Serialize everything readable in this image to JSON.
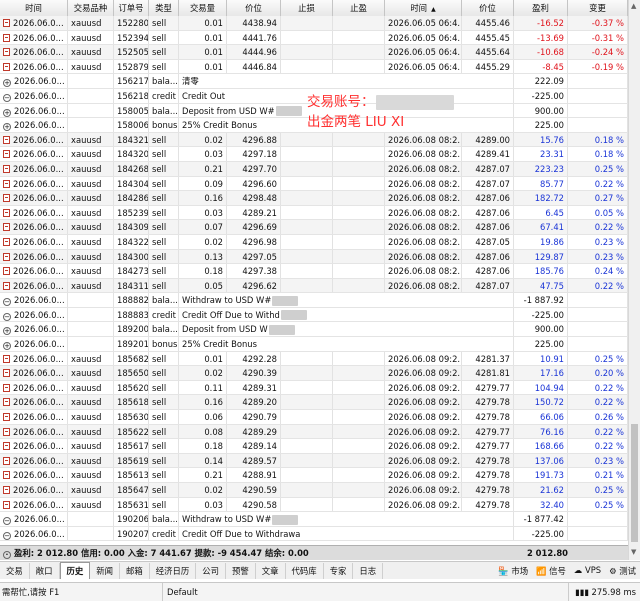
{
  "headers": [
    "时间",
    "交易品种",
    "订单号",
    "类型",
    "交易量",
    "价位",
    "止损",
    "止盈",
    "时间",
    "价位",
    "盈利",
    "变更"
  ],
  "sort_indicator": "▲",
  "rows": [
    {
      "kind": "trade",
      "time": "2026.06.0...",
      "symbol": "xauusd",
      "order": "152280",
      "type": "sell",
      "vol": "0.01",
      "price": "4438.94",
      "sl": "",
      "tp": "",
      "ctime": "2026.06.05 06:4...",
      "cprice": "4455.46",
      "profit": "-16.52",
      "chg": "-0.37 %",
      "sign": "neg"
    },
    {
      "kind": "trade",
      "time": "2026.06.0...",
      "symbol": "xauusd",
      "order": "152394",
      "type": "sell",
      "vol": "0.01",
      "price": "4441.76",
      "sl": "",
      "tp": "",
      "ctime": "2026.06.05 06:4...",
      "cprice": "4455.45",
      "profit": "-13.69",
      "chg": "-0.31 %",
      "sign": "neg"
    },
    {
      "kind": "trade",
      "time": "2026.06.0...",
      "symbol": "xauusd",
      "order": "152505",
      "type": "sell",
      "vol": "0.01",
      "price": "4444.96",
      "sl": "",
      "tp": "",
      "ctime": "2026.06.05 06:4...",
      "cprice": "4455.64",
      "profit": "-10.68",
      "chg": "-0.24 %",
      "sign": "neg"
    },
    {
      "kind": "trade",
      "time": "2026.06.0...",
      "symbol": "xauusd",
      "order": "152879",
      "type": "sell",
      "vol": "0.01",
      "price": "4446.84",
      "sl": "",
      "tp": "",
      "ctime": "2026.06.05 06:4...",
      "cprice": "4455.29",
      "profit": "-8.45",
      "chg": "-0.19 %",
      "sign": "neg"
    },
    {
      "kind": "bal",
      "mark": "+",
      "time": "2026.06.0...",
      "order": "156217",
      "type": "bala...",
      "comment": "清零",
      "masked": false,
      "profit": "222.09"
    },
    {
      "kind": "bal",
      "mark": "-",
      "time": "2026.06.0...",
      "order": "156218",
      "type": "credit",
      "comment": "Credit Out",
      "masked": false,
      "profit": "-225.00"
    },
    {
      "kind": "bal",
      "mark": "+",
      "time": "2026.06.0...",
      "order": "158005",
      "type": "bala...",
      "comment": "Deposit from USD W#",
      "masked": true,
      "profit": "900.00"
    },
    {
      "kind": "bal",
      "mark": "+",
      "time": "2026.06.0...",
      "order": "158006",
      "type": "bonus",
      "comment": "25% Credit Bonus",
      "masked": false,
      "profit": "225.00"
    },
    {
      "kind": "trade",
      "time": "2026.06.0...",
      "symbol": "xauusd",
      "order": "184321",
      "type": "sell",
      "vol": "0.02",
      "price": "4296.88",
      "sl": "",
      "tp": "",
      "ctime": "2026.06.08 08:2...",
      "cprice": "4289.00",
      "profit": "15.76",
      "chg": "0.18 %",
      "sign": "pos"
    },
    {
      "kind": "trade",
      "time": "2026.06.0...",
      "symbol": "xauusd",
      "order": "184320",
      "type": "sell",
      "vol": "0.03",
      "price": "4297.18",
      "sl": "",
      "tp": "",
      "ctime": "2026.06.08 08:2...",
      "cprice": "4289.41",
      "profit": "23.31",
      "chg": "0.18 %",
      "sign": "pos"
    },
    {
      "kind": "trade",
      "time": "2026.06.0...",
      "symbol": "xauusd",
      "order": "184268",
      "type": "sell",
      "vol": "0.21",
      "price": "4297.70",
      "sl": "",
      "tp": "",
      "ctime": "2026.06.08 08:2...",
      "cprice": "4287.07",
      "profit": "223.23",
      "chg": "0.25 %",
      "sign": "pos"
    },
    {
      "kind": "trade",
      "time": "2026.06.0...",
      "symbol": "xauusd",
      "order": "184304",
      "type": "sell",
      "vol": "0.09",
      "price": "4296.60",
      "sl": "",
      "tp": "",
      "ctime": "2026.06.08 08:2...",
      "cprice": "4287.07",
      "profit": "85.77",
      "chg": "0.22 %",
      "sign": "pos"
    },
    {
      "kind": "trade",
      "time": "2026.06.0...",
      "symbol": "xauusd",
      "order": "184286",
      "type": "sell",
      "vol": "0.16",
      "price": "4298.48",
      "sl": "",
      "tp": "",
      "ctime": "2026.06.08 08:2...",
      "cprice": "4287.06",
      "profit": "182.72",
      "chg": "0.27 %",
      "sign": "pos"
    },
    {
      "kind": "trade",
      "time": "2026.06.0...",
      "symbol": "xauusd",
      "order": "185239",
      "type": "sell",
      "vol": "0.03",
      "price": "4289.21",
      "sl": "",
      "tp": "",
      "ctime": "2026.06.08 08:2...",
      "cprice": "4287.06",
      "profit": "6.45",
      "chg": "0.05 %",
      "sign": "pos"
    },
    {
      "kind": "trade",
      "time": "2026.06.0...",
      "symbol": "xauusd",
      "order": "184309",
      "type": "sell",
      "vol": "0.07",
      "price": "4296.69",
      "sl": "",
      "tp": "",
      "ctime": "2026.06.08 08:2...",
      "cprice": "4287.06",
      "profit": "67.41",
      "chg": "0.22 %",
      "sign": "pos"
    },
    {
      "kind": "trade",
      "time": "2026.06.0...",
      "symbol": "xauusd",
      "order": "184322",
      "type": "sell",
      "vol": "0.02",
      "price": "4296.98",
      "sl": "",
      "tp": "",
      "ctime": "2026.06.08 08:2...",
      "cprice": "4287.05",
      "profit": "19.86",
      "chg": "0.23 %",
      "sign": "pos"
    },
    {
      "kind": "trade",
      "time": "2026.06.0...",
      "symbol": "xauusd",
      "order": "184300",
      "type": "sell",
      "vol": "0.13",
      "price": "4297.05",
      "sl": "",
      "tp": "",
      "ctime": "2026.06.08 08:2...",
      "cprice": "4287.06",
      "profit": "129.87",
      "chg": "0.23 %",
      "sign": "pos"
    },
    {
      "kind": "trade",
      "time": "2026.06.0...",
      "symbol": "xauusd",
      "order": "184273",
      "type": "sell",
      "vol": "0.18",
      "price": "4297.38",
      "sl": "",
      "tp": "",
      "ctime": "2026.06.08 08:2...",
      "cprice": "4287.06",
      "profit": "185.76",
      "chg": "0.24 %",
      "sign": "pos"
    },
    {
      "kind": "trade",
      "time": "2026.06.0...",
      "symbol": "xauusd",
      "order": "184311",
      "type": "sell",
      "vol": "0.05",
      "price": "4296.62",
      "sl": "",
      "tp": "",
      "ctime": "2026.06.08 08:2...",
      "cprice": "4287.07",
      "profit": "47.75",
      "chg": "0.22 %",
      "sign": "pos"
    },
    {
      "kind": "bal",
      "mark": "-",
      "time": "2026.06.0...",
      "order": "188882",
      "type": "bala...",
      "comment": "Withdraw to USD W#",
      "masked": true,
      "profit": "-1 887.92"
    },
    {
      "kind": "bal",
      "mark": "-",
      "time": "2026.06.0...",
      "order": "188883",
      "type": "credit",
      "comment": "Credit Off Due to Withd",
      "masked": true,
      "profit": "-225.00"
    },
    {
      "kind": "bal",
      "mark": "+",
      "time": "2026.06.0...",
      "order": "189200",
      "type": "bala...",
      "comment": "Deposit from USD W",
      "masked": true,
      "profit": "900.00"
    },
    {
      "kind": "bal",
      "mark": "+",
      "time": "2026.06.0...",
      "order": "189201",
      "type": "bonus",
      "comment": "25% Credit Bonus",
      "masked": false,
      "profit": "225.00"
    },
    {
      "kind": "trade",
      "time": "2026.06.0...",
      "symbol": "xauusd",
      "order": "185682",
      "type": "sell",
      "vol": "0.01",
      "price": "4292.28",
      "sl": "",
      "tp": "",
      "ctime": "2026.06.08 09:2...",
      "cprice": "4281.37",
      "profit": "10.91",
      "chg": "0.25 %",
      "sign": "pos"
    },
    {
      "kind": "trade",
      "time": "2026.06.0...",
      "symbol": "xauusd",
      "order": "185650",
      "type": "sell",
      "vol": "0.02",
      "price": "4290.39",
      "sl": "",
      "tp": "",
      "ctime": "2026.06.08 09:2...",
      "cprice": "4281.81",
      "profit": "17.16",
      "chg": "0.20 %",
      "sign": "pos"
    },
    {
      "kind": "trade",
      "time": "2026.06.0...",
      "symbol": "xauusd",
      "order": "185620",
      "type": "sell",
      "vol": "0.11",
      "price": "4289.31",
      "sl": "",
      "tp": "",
      "ctime": "2026.06.08 09:2...",
      "cprice": "4279.77",
      "profit": "104.94",
      "chg": "0.22 %",
      "sign": "pos"
    },
    {
      "kind": "trade",
      "time": "2026.06.0...",
      "symbol": "xauusd",
      "order": "185618",
      "type": "sell",
      "vol": "0.16",
      "price": "4289.20",
      "sl": "",
      "tp": "",
      "ctime": "2026.06.08 09:2...",
      "cprice": "4279.78",
      "profit": "150.72",
      "chg": "0.22 %",
      "sign": "pos"
    },
    {
      "kind": "trade",
      "time": "2026.06.0...",
      "symbol": "xauusd",
      "order": "185630",
      "type": "sell",
      "vol": "0.06",
      "price": "4290.79",
      "sl": "",
      "tp": "",
      "ctime": "2026.06.08 09:2...",
      "cprice": "4279.78",
      "profit": "66.06",
      "chg": "0.26 %",
      "sign": "pos"
    },
    {
      "kind": "trade",
      "time": "2026.06.0...",
      "symbol": "xauusd",
      "order": "185622",
      "type": "sell",
      "vol": "0.08",
      "price": "4289.29",
      "sl": "",
      "tp": "",
      "ctime": "2026.06.08 09:2...",
      "cprice": "4279.77",
      "profit": "76.16",
      "chg": "0.22 %",
      "sign": "pos"
    },
    {
      "kind": "trade",
      "time": "2026.06.0...",
      "symbol": "xauusd",
      "order": "185617",
      "type": "sell",
      "vol": "0.18",
      "price": "4289.14",
      "sl": "",
      "tp": "",
      "ctime": "2026.06.08 09:2...",
      "cprice": "4279.77",
      "profit": "168.66",
      "chg": "0.22 %",
      "sign": "pos"
    },
    {
      "kind": "trade",
      "time": "2026.06.0...",
      "symbol": "xauusd",
      "order": "185619",
      "type": "sell",
      "vol": "0.14",
      "price": "4289.57",
      "sl": "",
      "tp": "",
      "ctime": "2026.06.08 09:2...",
      "cprice": "4279.78",
      "profit": "137.06",
      "chg": "0.23 %",
      "sign": "pos"
    },
    {
      "kind": "trade",
      "time": "2026.06.0...",
      "symbol": "xauusd",
      "order": "185613",
      "type": "sell",
      "vol": "0.21",
      "price": "4288.91",
      "sl": "",
      "tp": "",
      "ctime": "2026.06.08 09:2...",
      "cprice": "4279.78",
      "profit": "191.73",
      "chg": "0.21 %",
      "sign": "pos"
    },
    {
      "kind": "trade",
      "time": "2026.06.0...",
      "symbol": "xauusd",
      "order": "185647",
      "type": "sell",
      "vol": "0.02",
      "price": "4290.59",
      "sl": "",
      "tp": "",
      "ctime": "2026.06.08 09:2...",
      "cprice": "4279.78",
      "profit": "21.62",
      "chg": "0.25 %",
      "sign": "pos"
    },
    {
      "kind": "trade",
      "time": "2026.06.0...",
      "symbol": "xauusd",
      "order": "185631",
      "type": "sell",
      "vol": "0.03",
      "price": "4290.58",
      "sl": "",
      "tp": "",
      "ctime": "2026.06.08 09:2...",
      "cprice": "4279.78",
      "profit": "32.40",
      "chg": "0.25 %",
      "sign": "pos"
    },
    {
      "kind": "bal",
      "mark": "-",
      "time": "2026.06.0...",
      "order": "190206",
      "type": "bala...",
      "comment": "Withdraw to USD W#",
      "masked": true,
      "profit": "-1 877.42"
    },
    {
      "kind": "bal",
      "mark": "-",
      "time": "2026.06.0...",
      "order": "190207",
      "type": "credit",
      "comment": "Credit Off Due to Withdrawa",
      "masked": false,
      "profit": "-225.00"
    }
  ],
  "summary": {
    "text": "盈利: 2 012.80  信用: 0.00  入金: 7 441.67  提款: -9 454.47  结余: 0.00",
    "total": "2 012.80"
  },
  "overlay": {
    "line1": "交易账号：",
    "line2": "出金两笔  LIU XI"
  },
  "tabs": [
    "交易",
    "敞口",
    "历史",
    "新闻",
    "邮箱",
    "经济日历",
    "公司",
    "预警",
    "文章",
    "代码库",
    "专家",
    "日志"
  ],
  "active_tab": "历史",
  "tabs_right": {
    "market": "市场",
    "signals": "信号",
    "vps": "VPS",
    "tester": "测试"
  },
  "status": {
    "help": "需帮忙,请按 F1",
    "profile": "Default",
    "traffic": "275.98 ms"
  }
}
